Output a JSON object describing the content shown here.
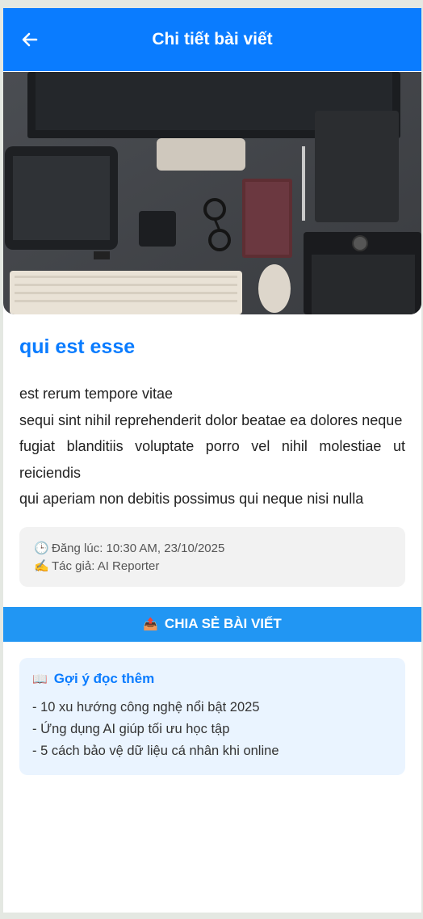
{
  "appbar": {
    "title": "Chi tiết bài viết",
    "back_icon": "arrow-left-icon",
    "color": "#0a7cff"
  },
  "post": {
    "title": "qui est esse",
    "body_lines": [
      "est rerum tempore vitae",
      "sequi sint nihil reprehenderit dolor beatae ea dolores neque",
      "fugiat blanditiis voluptate porro vel nihil molestiae ut reiciendis",
      "qui aperiam non debitis possimus qui neque nisi nulla"
    ]
  },
  "meta": {
    "posted_icon": "🕒",
    "posted": "Đăng lúc: 10:30 AM, 23/10/2025",
    "author_icon": "✍️",
    "author": "Tác giả: AI Reporter"
  },
  "share": {
    "icon": "📤",
    "label": "CHIA SẺ BÀI VIẾT",
    "color": "#2196f3"
  },
  "suggestions": {
    "icon": "📖",
    "title": "Gợi ý đọc thêm",
    "items": [
      "- 10 xu hướng công nghệ nổi bật 2025",
      "- Ứng dụng AI giúp tối ưu học tập",
      "- 5 cách bảo vệ dữ liệu cá nhân khi online"
    ]
  }
}
